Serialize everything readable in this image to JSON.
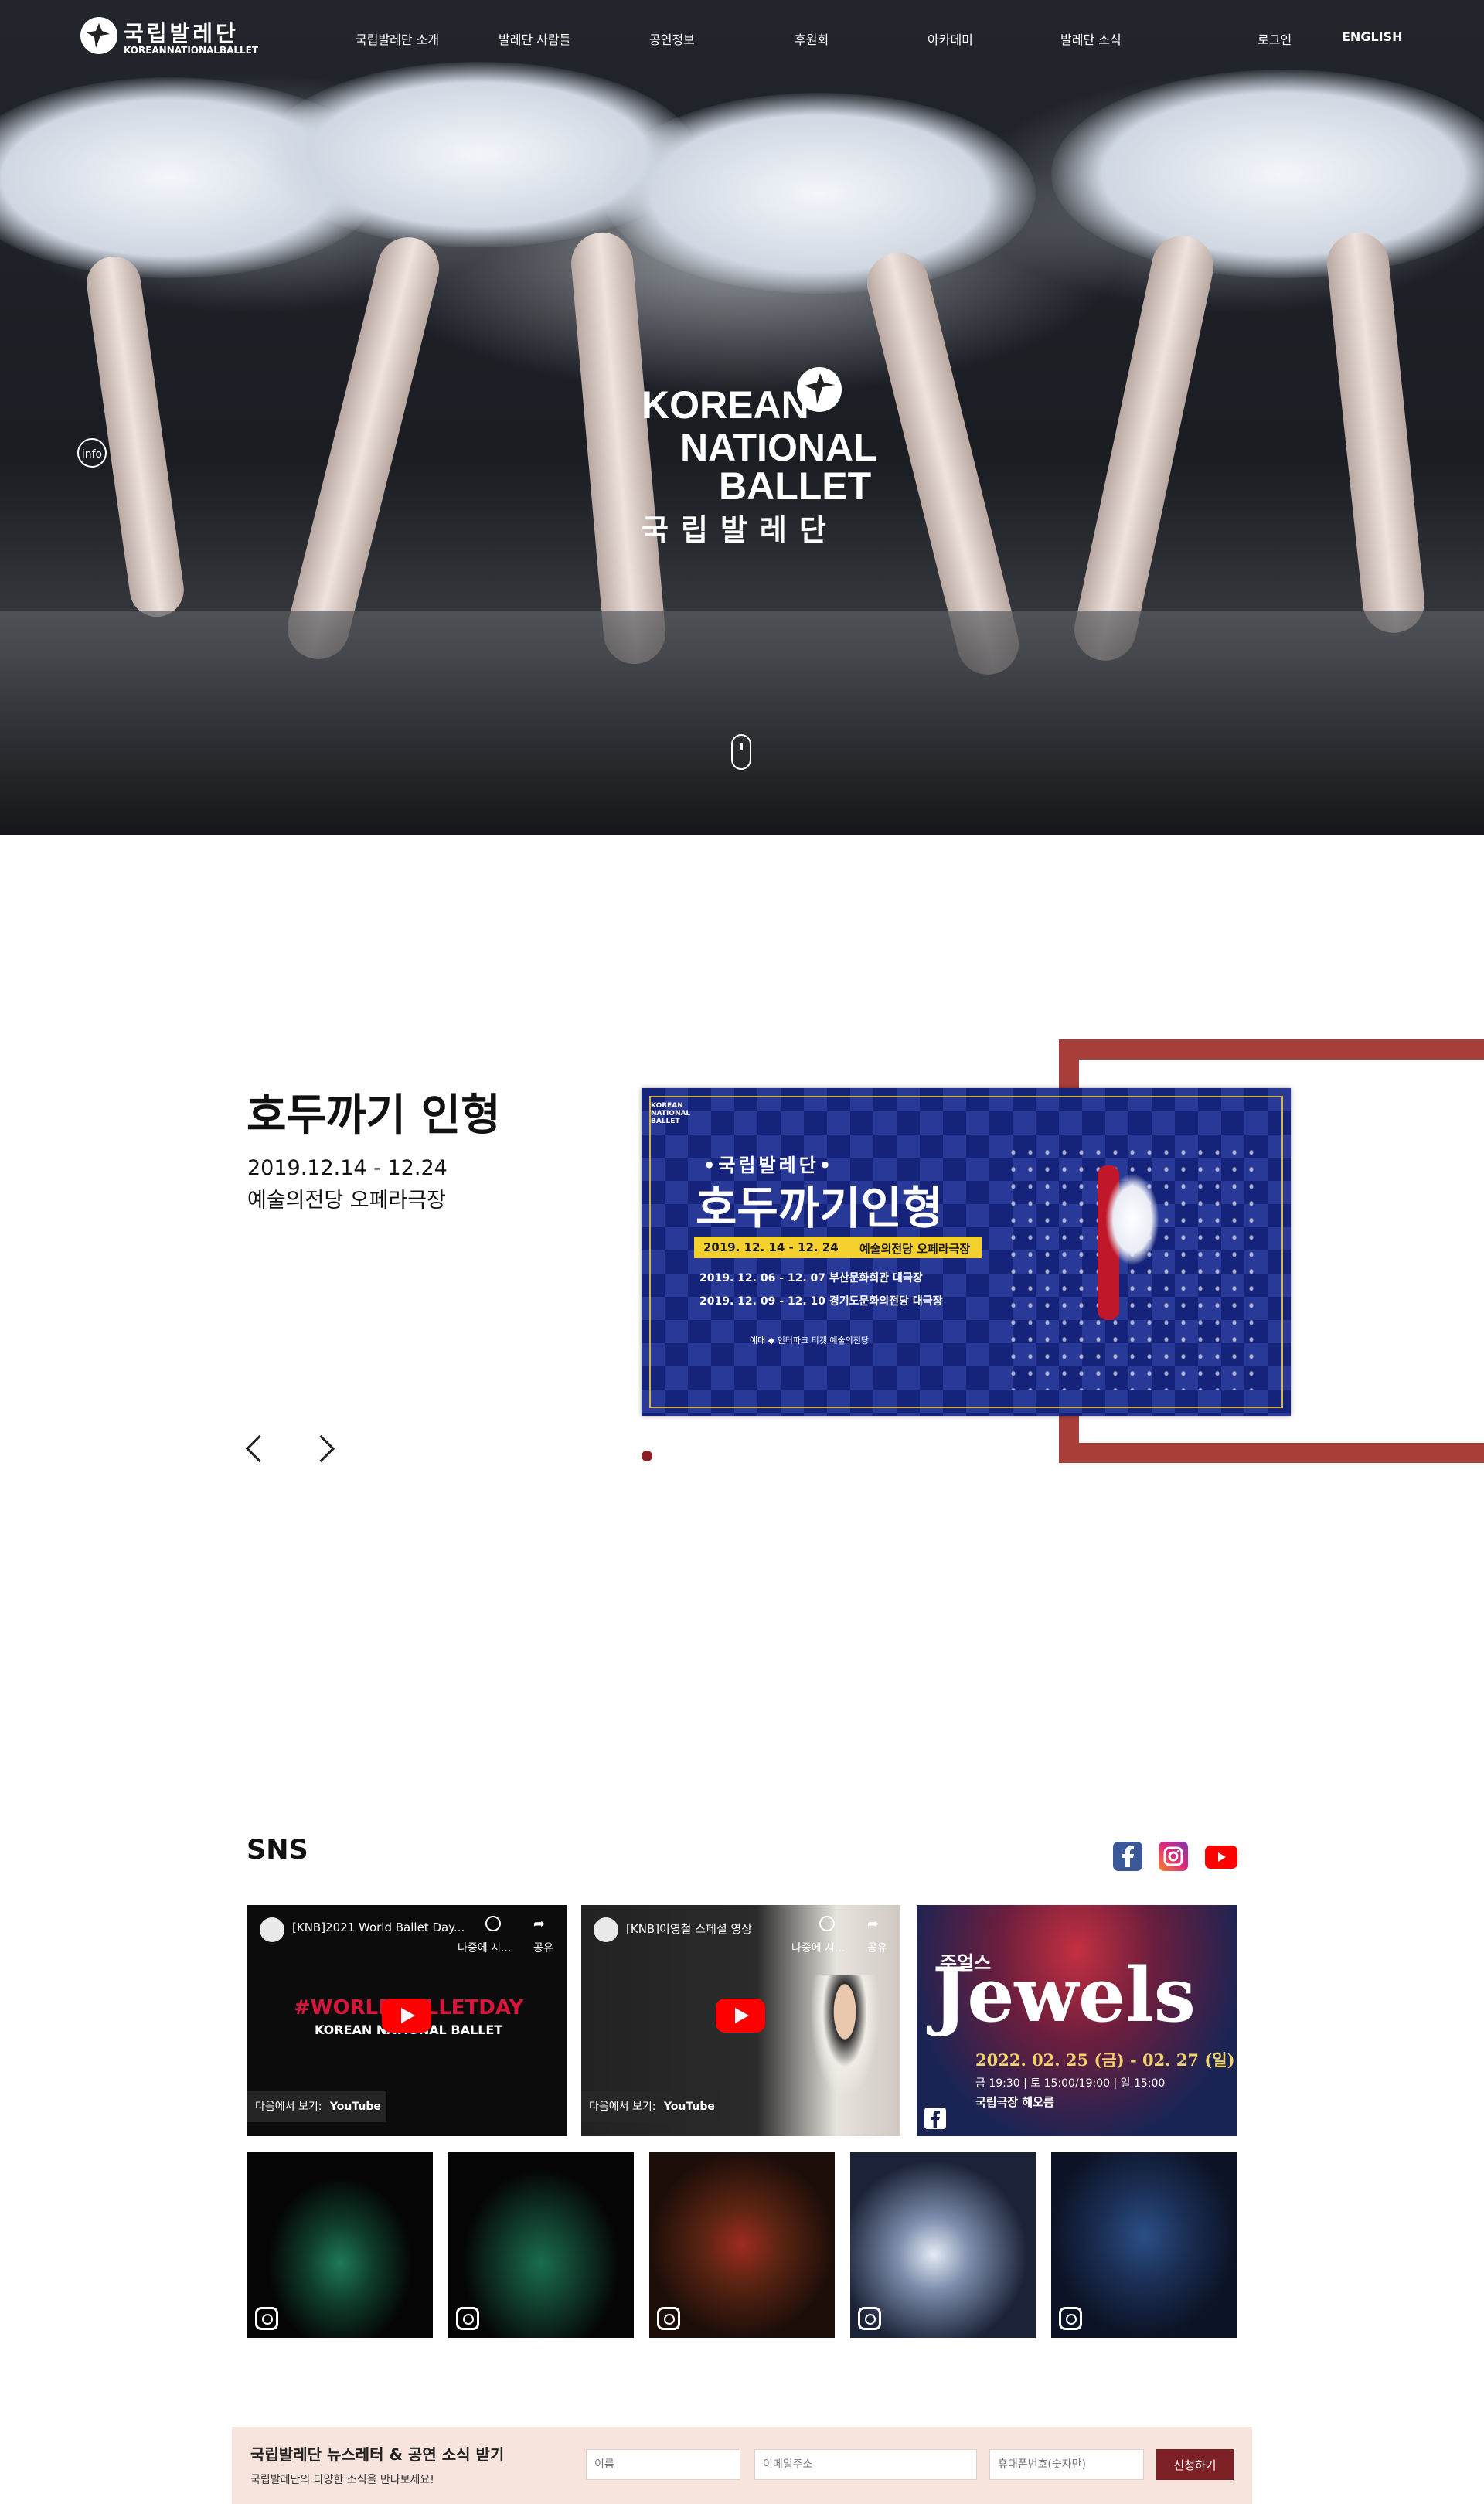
{
  "header": {
    "logo_kr": "국립발레단",
    "logo_en": "KOREANNATIONALBALLET",
    "nav": [
      "국립발레단 소개",
      "발레단 사람들",
      "공연정보",
      "후원회",
      "아카데미",
      "발레단 소식"
    ],
    "login": "로그인",
    "english": "ENGLISH"
  },
  "hero": {
    "info_label": "info",
    "center_logo": {
      "line1": "KOREAN",
      "line2": "NATIONAL",
      "line3": "BALLET",
      "line4": "국립발레단"
    }
  },
  "performance": {
    "title": "호두까기 인형",
    "date": "2019.12.14 - 12.24",
    "venue": "예술의전당 오페라극장",
    "poster": {
      "brand_top": "KOREAN\nNATIONAL\nBALLET",
      "subtitle": "•국립발레단•",
      "title": "호두까기인형",
      "bar_date": "2019. 12. 14 - 12. 24",
      "bar_venue": "예술의전당 오페라극장",
      "line1": "2019. 12. 06 - 12. 07  부산문화회관 대극장",
      "line2": "2019. 12. 09 - 12. 10  경기도문화의전당 대극장",
      "sponsors": "예매  ◆  인터파크 티켓  예술의전당"
    },
    "slide_count": 1,
    "active_slide": 1
  },
  "sns": {
    "title": "SNS",
    "icons": [
      "facebook-icon",
      "instagram-icon",
      "youtube-icon"
    ],
    "videos": [
      {
        "title": "[KNB]2021 World Ballet Day...",
        "later": "나중에 시...",
        "share": "공유",
        "overlay1": "#WORLDBALLETDAY",
        "overlay2": "KOREAN NATIONAL BALLET",
        "watch_on": "다음에서 보기:",
        "yt": "YouTube"
      },
      {
        "title": "[KNB]이영철 스페셜 영상",
        "later": "나중에 시...",
        "share": "공유",
        "watch_on": "다음에서 보기:",
        "yt": "YouTube"
      }
    ],
    "jewels": {
      "kr": "주얼스",
      "title": "Jewels",
      "dates": "2022. 02. 25 (금) - 02. 27 (일)",
      "times": "금 19:30 | 토 15:00/19:00 | 일 15:00",
      "venue": "국립극장 해오름"
    },
    "instagram_posts": 5
  },
  "newsletter": {
    "title": "국립발레단 뉴스레터 & 공연 소식 받기",
    "subtitle": "국립발레단의 다양한 소식을 만나보세요!",
    "name_placeholder": "이름",
    "email_placeholder": "이메일주소",
    "phone_placeholder": "휴대폰번호(숫자만)",
    "submit": "신청하기"
  },
  "colors": {
    "accent": "#a83e3a",
    "button": "#7d2026",
    "newsletter_bg": "#f7e4dd",
    "poster_bg": "#15237a"
  }
}
